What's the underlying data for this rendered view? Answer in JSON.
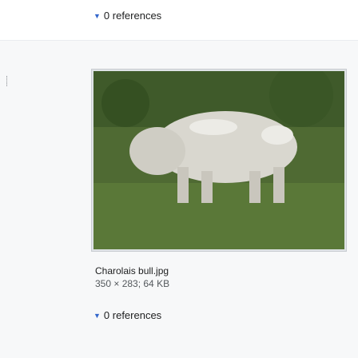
{
  "references_top": {
    "label": "0 references"
  },
  "image": {
    "filename": "Charolais bull.jpg",
    "meta": "350 × 283; 64 KB"
  },
  "references_bottom": {
    "label": "0 references"
  },
  "icons": {
    "side": "drag-handle-icon",
    "toggle": "chevron-down-icon"
  }
}
